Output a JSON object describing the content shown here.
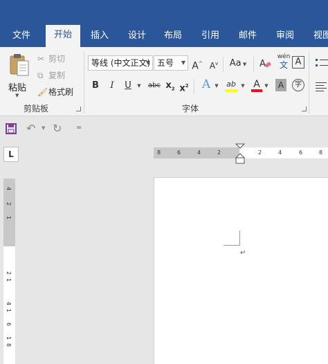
{
  "tabs": [
    {
      "label": "文件",
      "active": false
    },
    {
      "label": "开始",
      "active": true
    },
    {
      "label": "插入",
      "active": false
    },
    {
      "label": "设计",
      "active": false
    },
    {
      "label": "布局",
      "active": false
    },
    {
      "label": "引用",
      "active": false
    },
    {
      "label": "邮件",
      "active": false
    },
    {
      "label": "审阅",
      "active": false
    },
    {
      "label": "视图",
      "active": false
    }
  ],
  "clipboard": {
    "paste_label": "粘贴",
    "cut_label": "剪切",
    "copy_label": "复制",
    "format_painter_label": "格式刷",
    "group_label": "剪贴板"
  },
  "font": {
    "font_name": "等线 (中文正文)",
    "font_size": "五号",
    "grow_label": "A",
    "shrink_label": "A",
    "case_label": "Aa",
    "phonetic_label": "wén",
    "phonetic_sub": "文",
    "border_label": "A",
    "bold_label": "B",
    "italic_label": "I",
    "underline_label": "U",
    "strike_label": "abc",
    "subscript_label": "x",
    "superscript_label": "x",
    "effects_label": "A",
    "highlight_label": "ab",
    "font_color_label": "A",
    "shade_label": "A",
    "enclose_label": "字",
    "group_label": "字体"
  },
  "colors": {
    "brand": "#2b579a",
    "highlight": "#ffff00",
    "font_color": "#e81123",
    "save": "#7e3d9b"
  },
  "qat": {
    "customize_label": "="
  },
  "ruler": {
    "corner_label": "L",
    "h_numbers": [
      "8",
      "6",
      "4",
      "2",
      "2",
      "4",
      "6",
      "8"
    ],
    "v_numbers": [
      "4",
      "2",
      "1",
      "2",
      "1",
      "4",
      "1",
      "6",
      "1",
      "8"
    ]
  },
  "document": {
    "paragraph_mark": "↵"
  }
}
